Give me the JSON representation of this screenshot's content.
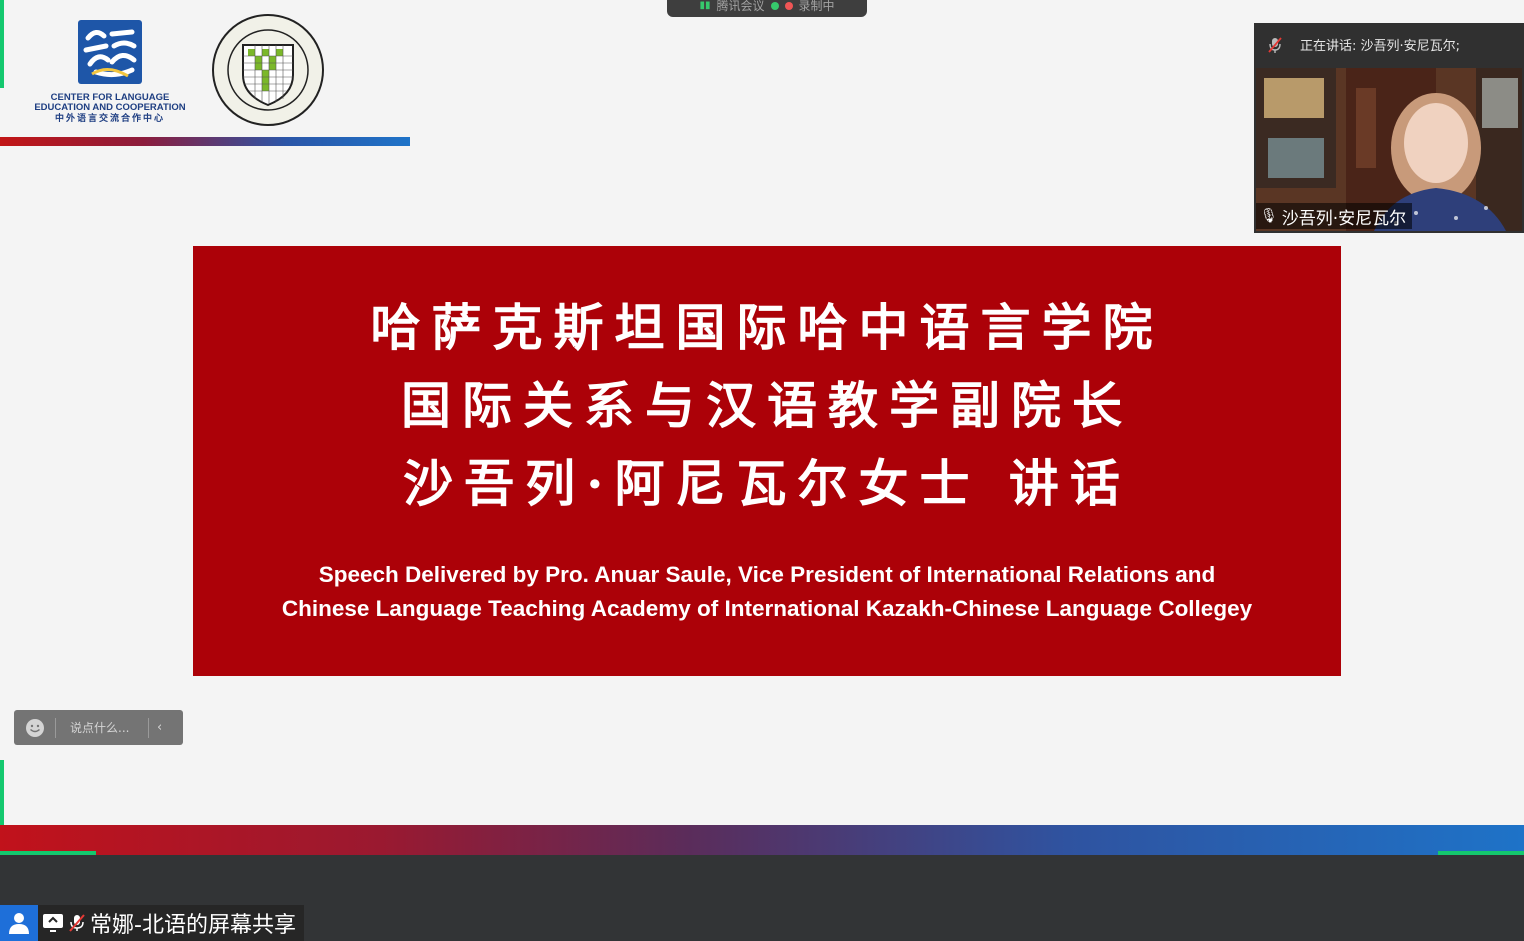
{
  "meeting": {
    "app_name": "腾讯会议",
    "recording_label": "录制中"
  },
  "logos": {
    "clec_en_line1": "CENTER FOR LANGUAGE",
    "clec_en_line2": "EDUCATION AND COOPERATION",
    "clec_cn": "中外语言交流合作中心"
  },
  "speaker_panel": {
    "now_speaking": "正在讲话: 沙吾列·安尼瓦尔;",
    "name": "沙吾列·安尼瓦尔"
  },
  "slide": {
    "cn_line1": "哈萨克斯坦国际哈中语言学院",
    "cn_line2": "国际关系与汉语教学副院长",
    "cn_line3": "沙吾列·阿尼瓦尔女士  讲话",
    "en_line1": "Speech Delivered by Pro. Anuar Saule, Vice President of International Relations and",
    "en_line2": "Chinese Language Teaching Academy of  International Kazakh-Chinese Language Collegey"
  },
  "chat": {
    "placeholder": "说点什么..."
  },
  "screen_share": {
    "label": "常娜-北语的屏幕共享"
  },
  "colors": {
    "slide_red": "#ac0108",
    "share_blue": "#1e6fd9",
    "accent_green": "#14c86e"
  }
}
